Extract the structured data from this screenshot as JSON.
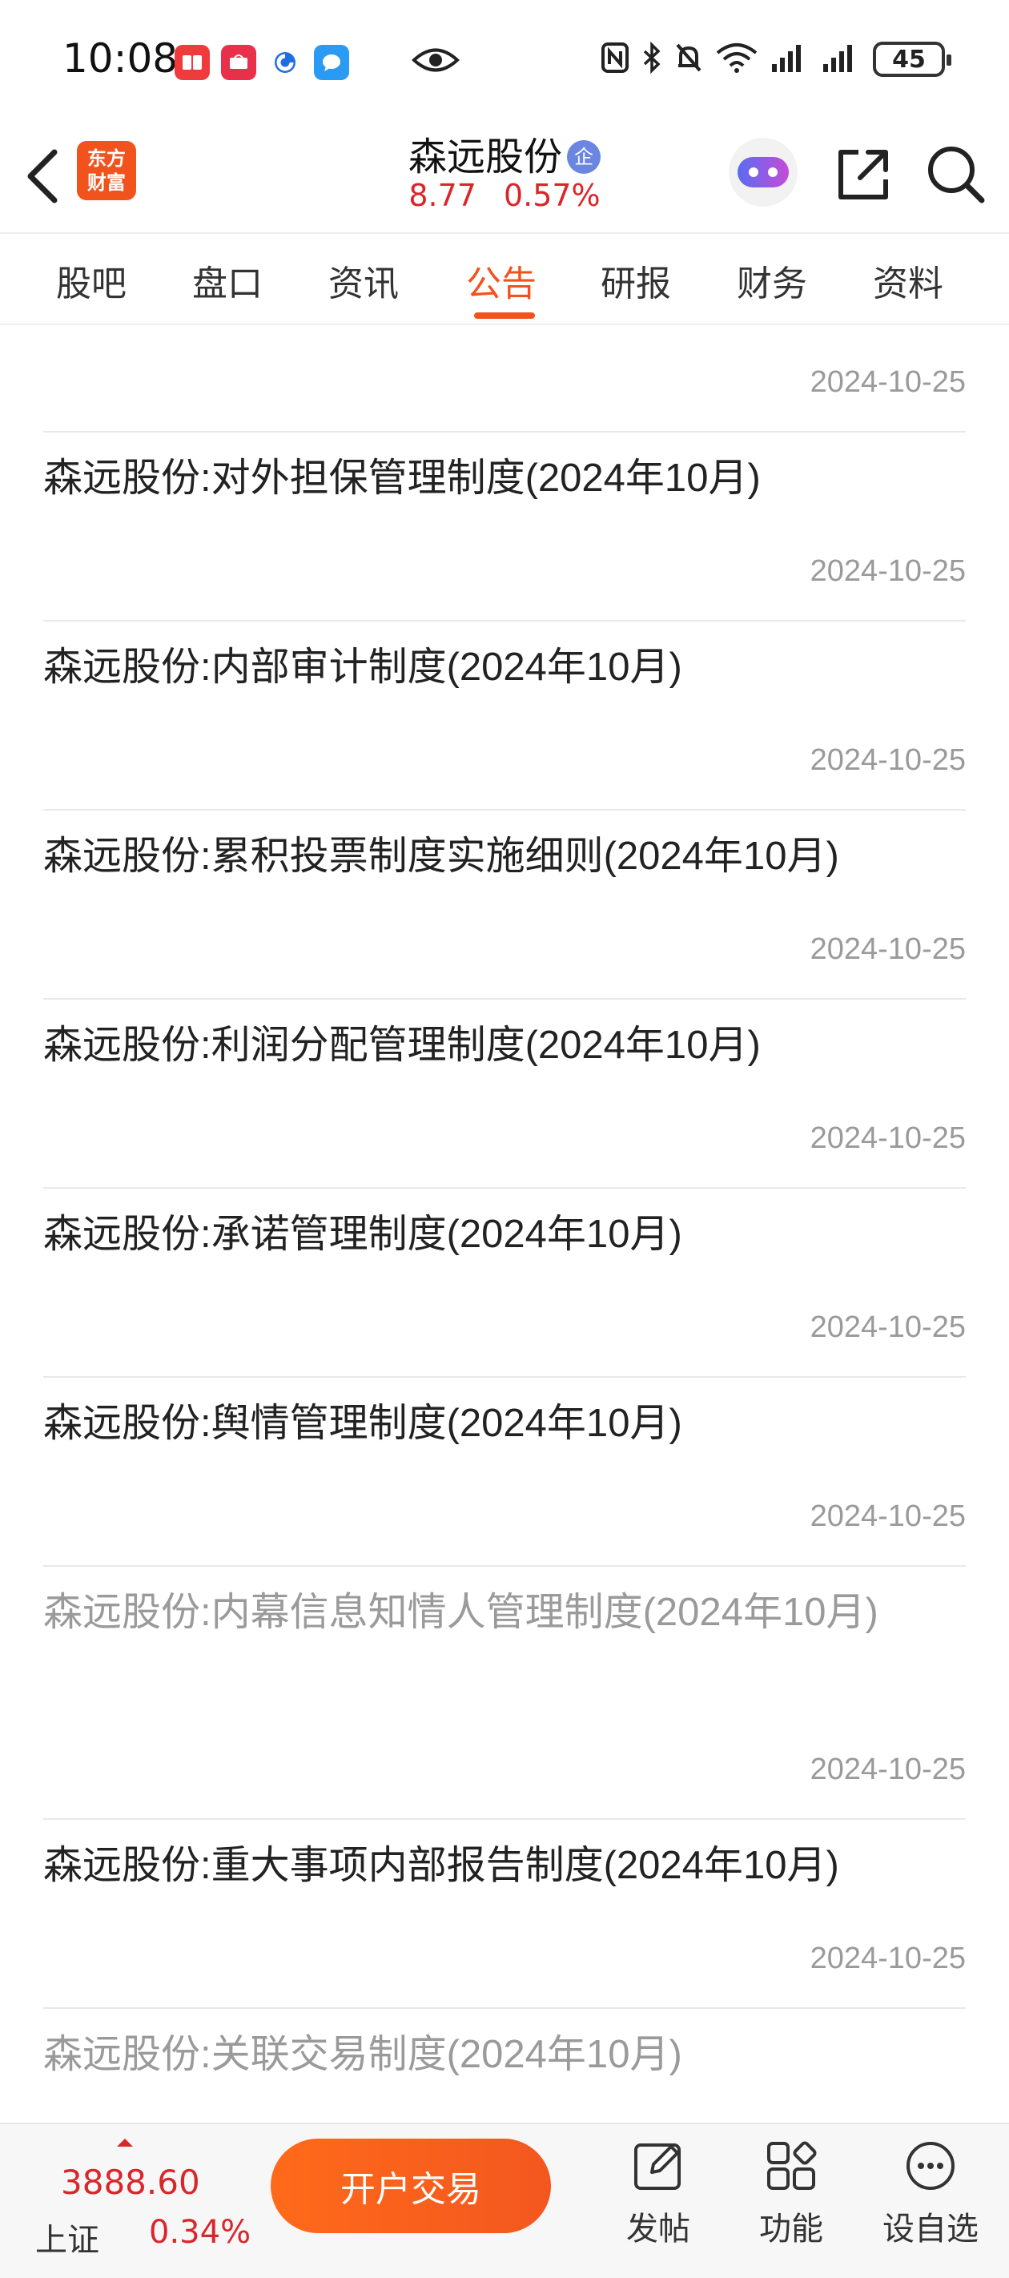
{
  "status_bar": {
    "time": "10:08",
    "battery": "45",
    "app_icons": [
      "xiaohongshu-icon",
      "huawei-icon",
      "browser-icon",
      "message-icon"
    ]
  },
  "header": {
    "logo_line1": "东方",
    "logo_line2": "财富",
    "stock_name": "森远股份",
    "badge": "企",
    "price": "8.77",
    "change_pct": "0.57%"
  },
  "tabs": [
    {
      "label": "股吧"
    },
    {
      "label": "盘口"
    },
    {
      "label": "资讯"
    },
    {
      "label": "公告",
      "active": true
    },
    {
      "label": "研报"
    },
    {
      "label": "财务"
    },
    {
      "label": "资料"
    }
  ],
  "announcements": [
    {
      "title": "",
      "date": "2024-10-25"
    },
    {
      "title": "森远股份:对外担保管理制度(2024年10月)",
      "date": "2024-10-25"
    },
    {
      "title": "森远股份:内部审计制度(2024年10月)",
      "date": "2024-10-25"
    },
    {
      "title": "森远股份:累积投票制度实施细则(2024年10月)",
      "date": "2024-10-25"
    },
    {
      "title": "森远股份:利润分配管理制度(2024年10月)",
      "date": "2024-10-25"
    },
    {
      "title": "森远股份:承诺管理制度(2024年10月)",
      "date": "2024-10-25"
    },
    {
      "title": "森远股份:舆情管理制度(2024年10月)",
      "date": "2024-10-25"
    },
    {
      "title": "森远股份:内幕信息知情人管理制度(2024年10月)",
      "date": "2024-10-25",
      "read": true
    },
    {
      "title": "森远股份:重大事项内部报告制度(2024年10月)",
      "date": "2024-10-25"
    },
    {
      "title": "森远股份:关联交易制度(2024年10月)",
      "date": "",
      "read": true
    }
  ],
  "bottom_bar": {
    "index_value": "3888.60",
    "index_name": "上证",
    "index_change": "0.34%",
    "open_trade_label": "开户交易",
    "tools": [
      {
        "label": "发帖",
        "icon": "edit-icon"
      },
      {
        "label": "功能",
        "icon": "grid-icon"
      },
      {
        "label": "设自选",
        "icon": "more-icon"
      }
    ]
  },
  "colors": {
    "accent": "#f2531d",
    "up_red": "#d9262b",
    "muted_text": "#9a9a9a"
  }
}
